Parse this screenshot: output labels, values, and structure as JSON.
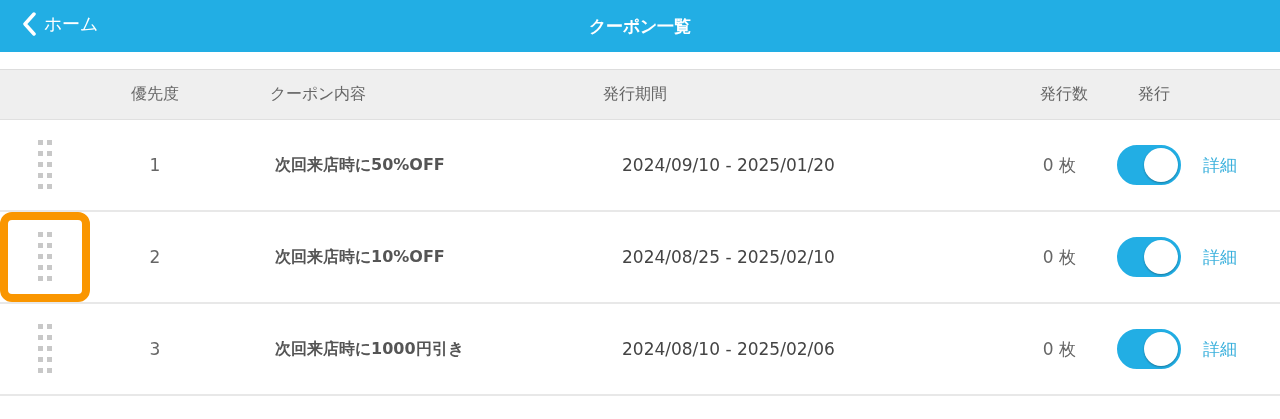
{
  "nav_bar": {
    "back_label": "ホーム",
    "title": "クーポン一覧"
  },
  "table": {
    "columns": [
      "優先度",
      "クーポン内容",
      "発行期間",
      "発行数",
      "発行"
    ],
    "rows": [
      {
        "priority": "1",
        "content": "次回来店時に50%OFF",
        "period": "2024/09/10 - 2025/01/20",
        "count": "0 枚",
        "on": true,
        "detail": "詳細",
        "highlighted": false
      },
      {
        "priority": "2",
        "content": "次回来店時に10%OFF",
        "period": "2024/08/25 - 2025/02/10",
        "count": "0 枚",
        "on": true,
        "detail": "詳細",
        "highlighted": true
      },
      {
        "priority": "3",
        "content": "次回来店時に1000円引き",
        "period": "2024/08/10 - 2025/02/06",
        "count": "0 枚",
        "on": true,
        "detail": "詳細",
        "highlighted": false
      }
    ]
  }
}
